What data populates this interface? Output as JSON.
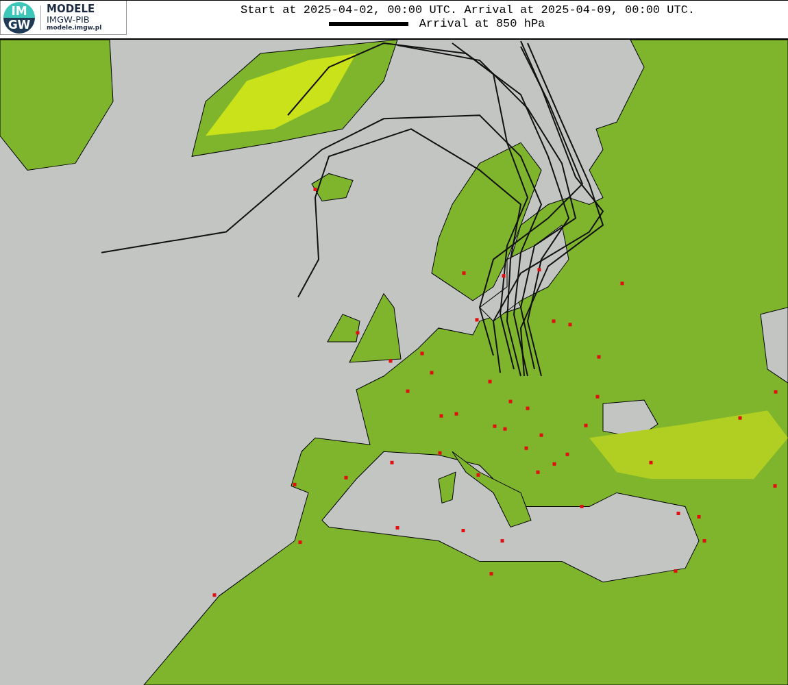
{
  "logo": {
    "mark": [
      "IM",
      "GW"
    ],
    "name": "MODELE",
    "org": "IMGW-PIB",
    "url": "modele.imgw.pl"
  },
  "title": "Start at 2025-04-02, 00:00 UTC. Arrival at 2025-04-09, 00:00 UTC.",
  "legend": {
    "label": "Arrival at 850 hPa"
  }
}
